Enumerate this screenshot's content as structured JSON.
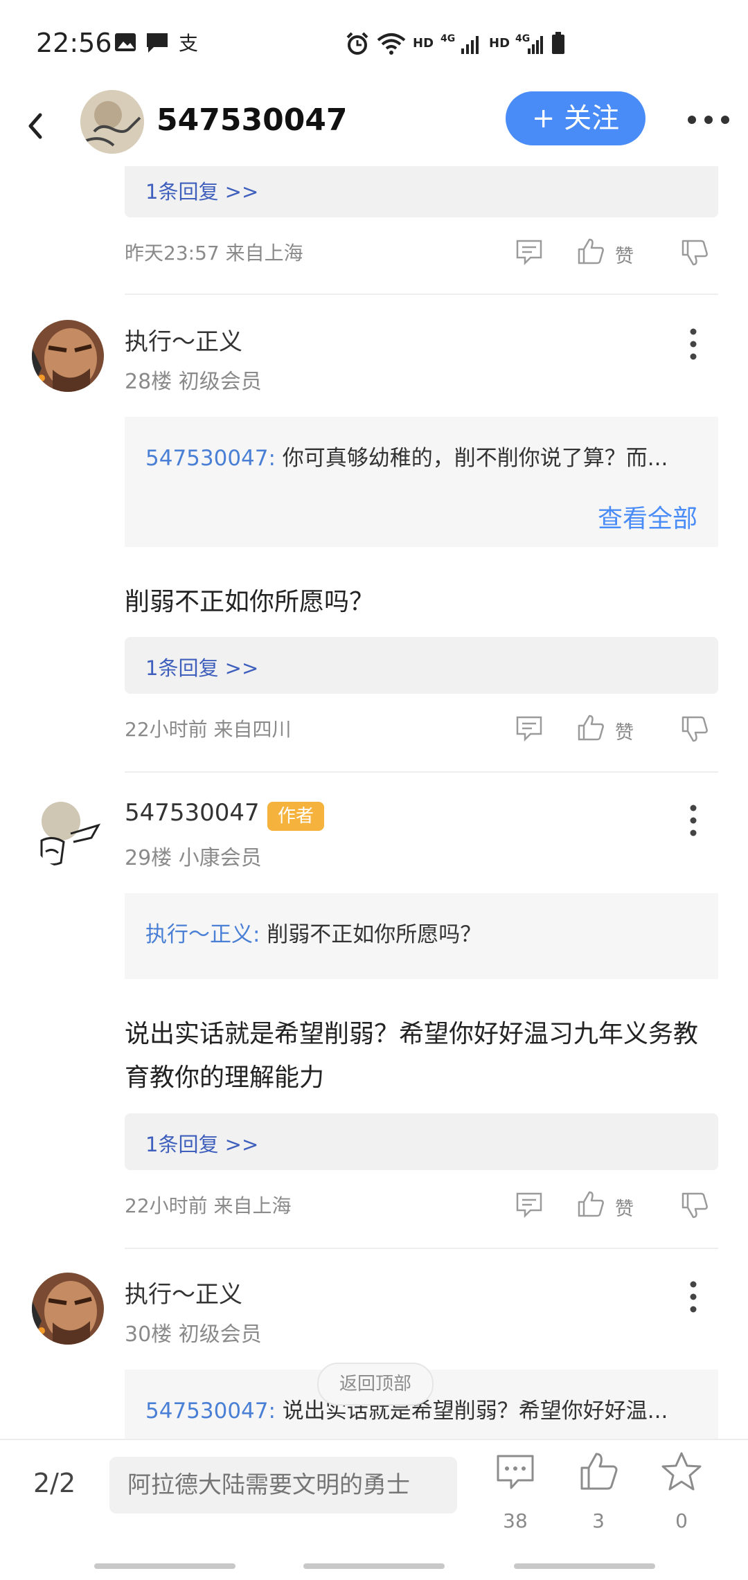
{
  "status_bar": {
    "time": "22:56"
  },
  "header": {
    "username": "547530047",
    "follow_label": "+ 关注"
  },
  "posts": [
    {
      "reply_link": "1条回复 >>",
      "meta": "昨天23:57 来自上海",
      "like_label": "赞"
    },
    {
      "username": "执行～正义",
      "floor": "28楼 初级会员",
      "quote_name": "547530047:",
      "quote_text": " 你可真够幼稚的，削不削你说了算？而...",
      "view_all": "查看全部",
      "text": "削弱不正如你所愿吗？",
      "reply_link": "1条回复 >>",
      "meta": "22小时前 来自四川",
      "like_label": "赞"
    },
    {
      "username": "547530047",
      "badge": "作者",
      "floor": "29楼 小康会员",
      "quote_name": "执行～正义:",
      "quote_text": " 削弱不正如你所愿吗？",
      "text": "说出实话就是希望削弱？希望你好好温习九年义务教育教你的理解能力",
      "reply_link": "1条回复 >>",
      "meta": "22小时前 来自上海",
      "like_label": "赞"
    },
    {
      "username": "执行～正义",
      "floor": "30楼 初级会员",
      "quote_name": "547530047:",
      "quote_text": " 说出实话就是希望削弱？希望你好好温..."
    }
  ],
  "back_to_top": "返回顶部",
  "bottom_bar": {
    "page_indicator": "2/2",
    "input_placeholder": "阿拉德大陆需要文明的勇士",
    "comments_count": "38",
    "likes_count": "3",
    "favorites_count": "0"
  },
  "colors": {
    "accent": "#4a8cf7",
    "link": "#3f5fbd",
    "badge": "#f5b23c"
  }
}
